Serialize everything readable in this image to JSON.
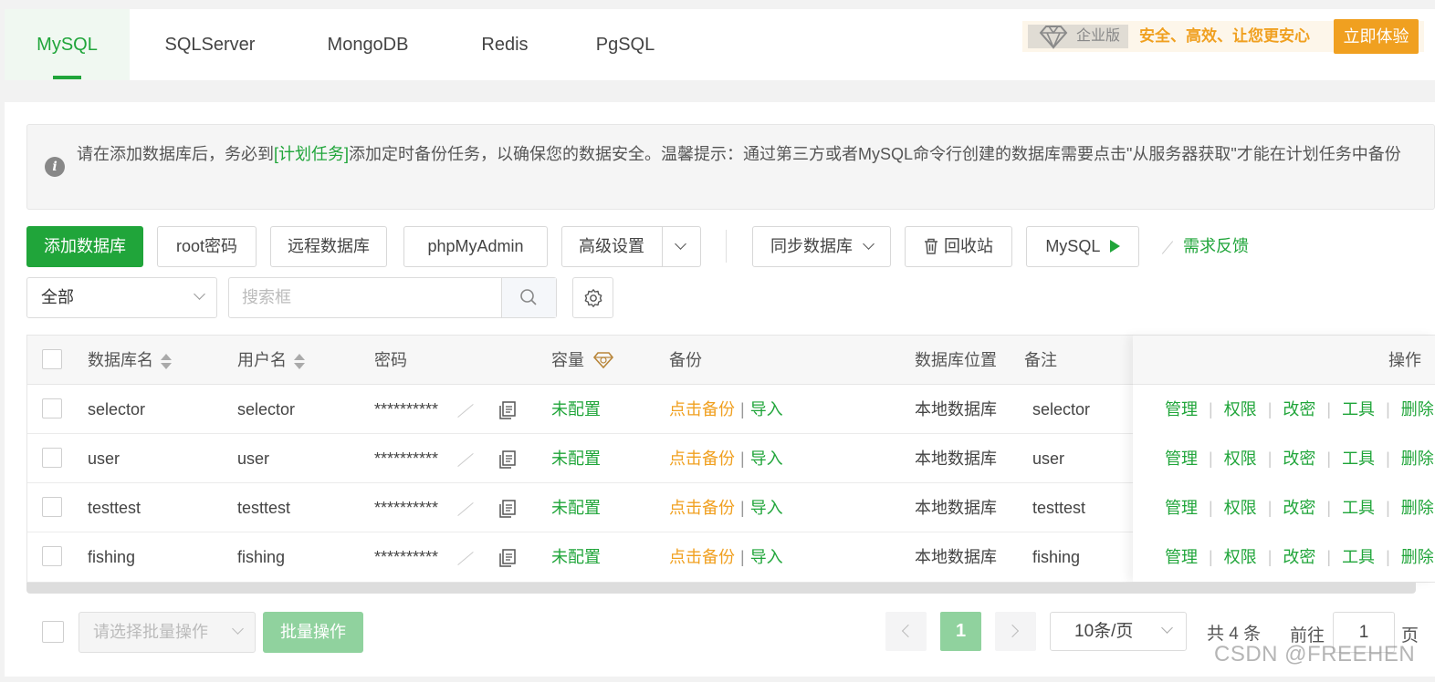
{
  "db_tabs": [
    {
      "label": "MySQL",
      "active": true
    },
    {
      "label": "SQLServer"
    },
    {
      "label": "MongoDB"
    },
    {
      "label": "Redis"
    },
    {
      "label": "PgSQL"
    }
  ],
  "promo": {
    "badge": "企业版",
    "text": "安全、高效、让您更安心",
    "button": "立即体验"
  },
  "notice": {
    "before": "请在添加数据库后，务必到",
    "link": "[计划任务]",
    "after": "添加定时备份任务，以确保您的数据安全。温馨提示：通过第三方或者MySQL命令行创建的数据库需要点击\"从服务器获取\"才能在计划任务中备份"
  },
  "toolbar": {
    "add_db": "添加数据库",
    "root_pwd": "root密码",
    "remote_db": "远程数据库",
    "phpmyadmin": "phpMyAdmin",
    "advanced": "高级设置",
    "sync_db": "同步数据库",
    "recycle": "回收站",
    "mysql": "MySQL",
    "feedback": "需求反馈"
  },
  "filter": {
    "scope": "全部",
    "search_placeholder": "搜索框"
  },
  "table": {
    "headers": {
      "name": "数据库名",
      "user": "用户名",
      "password": "密码",
      "capacity": "容量",
      "backup": "备份",
      "location": "数据库位置",
      "remark": "备注",
      "ops": "操作"
    },
    "rows": [
      {
        "name": "selector",
        "user": "selector",
        "password": "**********",
        "capacity": "未配置",
        "backup": "点击备份",
        "import": "导入",
        "location": "本地数据库",
        "remark": "selector"
      },
      {
        "name": "user",
        "user": "user",
        "password": "**********",
        "capacity": "未配置",
        "backup": "点击备份",
        "import": "导入",
        "location": "本地数据库",
        "remark": "user"
      },
      {
        "name": "testtest",
        "user": "testtest",
        "password": "**********",
        "capacity": "未配置",
        "backup": "点击备份",
        "import": "导入",
        "location": "本地数据库",
        "remark": "testtest"
      },
      {
        "name": "fishing",
        "user": "fishing",
        "password": "**********",
        "capacity": "未配置",
        "backup": "点击备份",
        "import": "导入",
        "location": "本地数据库",
        "remark": "fishing"
      }
    ],
    "op_labels": [
      "管理",
      "权限",
      "改密",
      "工具",
      "删除"
    ]
  },
  "footer": {
    "batch_placeholder": "请选择批量操作",
    "batch_button": "批量操作",
    "current_page": "1",
    "page_size": "10条/页",
    "total": "共 4 条",
    "goto_label": "前往",
    "goto_value": "1",
    "page_unit": "页"
  },
  "watermark": "CSDN @FREEHEN",
  "colors": {
    "primary": "#20a53a",
    "warning": "#f0a020"
  }
}
